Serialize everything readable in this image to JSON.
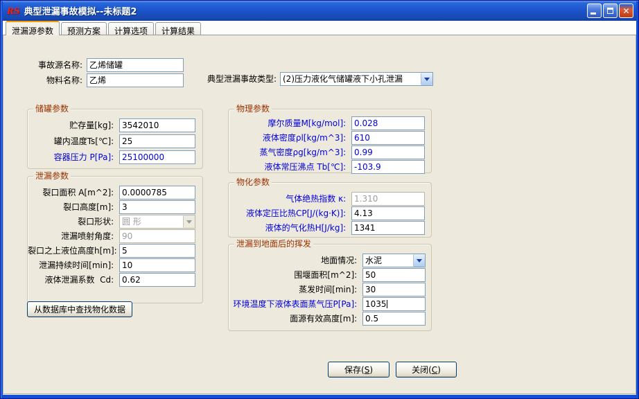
{
  "window": {
    "title": "典型泄漏事故模拟--未标题2",
    "icon_text": "RS"
  },
  "tabs": [
    {
      "label": "泄漏源参数",
      "active": true
    },
    {
      "label": "预测方案",
      "active": false
    },
    {
      "label": "计算选项",
      "active": false
    },
    {
      "label": "计算结果",
      "active": false
    }
  ],
  "header_fields": {
    "source_name": {
      "label": "事故源名称:",
      "value": "乙烯储罐"
    },
    "material_name": {
      "label": "物料名称:",
      "value": "乙烯"
    },
    "accident_type": {
      "label": "典型泄漏事故类型:",
      "value": "(2)压力液化气储罐液下小孔泄漏"
    }
  },
  "groups": {
    "tank": {
      "title": "储罐参数",
      "rows": [
        {
          "label": "贮存量[kg]: ",
          "value": "3542010"
        },
        {
          "label": "罐内温度Ts[℃]: ",
          "value": "25"
        },
        {
          "label": "容器压力 P[Pa]: ",
          "value": "25100000",
          "blue_label": true,
          "blue_value": true
        }
      ]
    },
    "leak": {
      "title": "泄漏参数",
      "rows": [
        {
          "label": "裂口面积 A[m^2]: ",
          "value": "0.0000785"
        },
        {
          "label": "裂口高度[m]: ",
          "value": "3"
        },
        {
          "label": "裂口形状: ",
          "value": "圆 形",
          "type": "combo",
          "disabled": true
        },
        {
          "label": "泄漏喷射角度: ",
          "value": "90",
          "disabled": true
        },
        {
          "label": "裂口之上液位高度h[m]: ",
          "value": "5"
        },
        {
          "label": "泄漏持续时间[min]: ",
          "value": "10"
        },
        {
          "label": "液体泄漏系数  Cd: ",
          "value": "0.62"
        }
      ]
    },
    "physical": {
      "title": "物理参数",
      "rows": [
        {
          "label": "摩尔质量M[kg/mol]: ",
          "value": "0.028",
          "blue_label": true,
          "blue_value": true
        },
        {
          "label": "液体密度ρl[kg/m^3]: ",
          "value": "610",
          "blue_label": true,
          "blue_value": true
        },
        {
          "label": "蒸气密度ρg[kg/m^3]: ",
          "value": "0.99",
          "blue_label": true,
          "blue_value": true
        },
        {
          "label": "液体常压沸点 Tb[℃]: ",
          "value": "-103.9",
          "blue_label": true,
          "blue_value": true
        }
      ]
    },
    "physchem": {
      "title": "物化参数",
      "rows": [
        {
          "label": "气体绝热指数 κ: ",
          "value": "1.310",
          "blue_label": true,
          "disabled": true
        },
        {
          "label": "液体定压比热CP[J/(kg·K)]: ",
          "value": "4.13",
          "blue_label": true
        },
        {
          "label": "液体的气化热H[J/kg]: ",
          "value": "1341",
          "blue_label": true
        }
      ]
    },
    "evaporation": {
      "title": "泄漏到地面后的挥发",
      "rows": [
        {
          "label": "地面情况: ",
          "value": "水泥",
          "type": "combo"
        },
        {
          "label": "围堰面积[m^2]: ",
          "value": "50"
        },
        {
          "label": "蒸发时间[min]: ",
          "value": "30"
        },
        {
          "label": "环境温度下液体表面蒸气压P[Pa]: ",
          "value": "1035",
          "blue_label": true,
          "caret": true
        },
        {
          "label": "面源有效高度[m]: ",
          "value": "0.5"
        }
      ]
    }
  },
  "buttons": {
    "db_lookup": "从数据库中查找物化数据",
    "save": {
      "pre": "保存(",
      "key": "S",
      "suf": ")"
    },
    "close": {
      "pre": "关闭(",
      "key": "C",
      "suf": ")"
    }
  },
  "colors": {
    "accent_blue_label": "#0000E0",
    "group_title": "#993300",
    "input_border": "#7F9DB9",
    "titlebar_blue": "#1C55CC",
    "active_tab_orange": "#F59A00",
    "page_background": "#EDE9DC"
  }
}
